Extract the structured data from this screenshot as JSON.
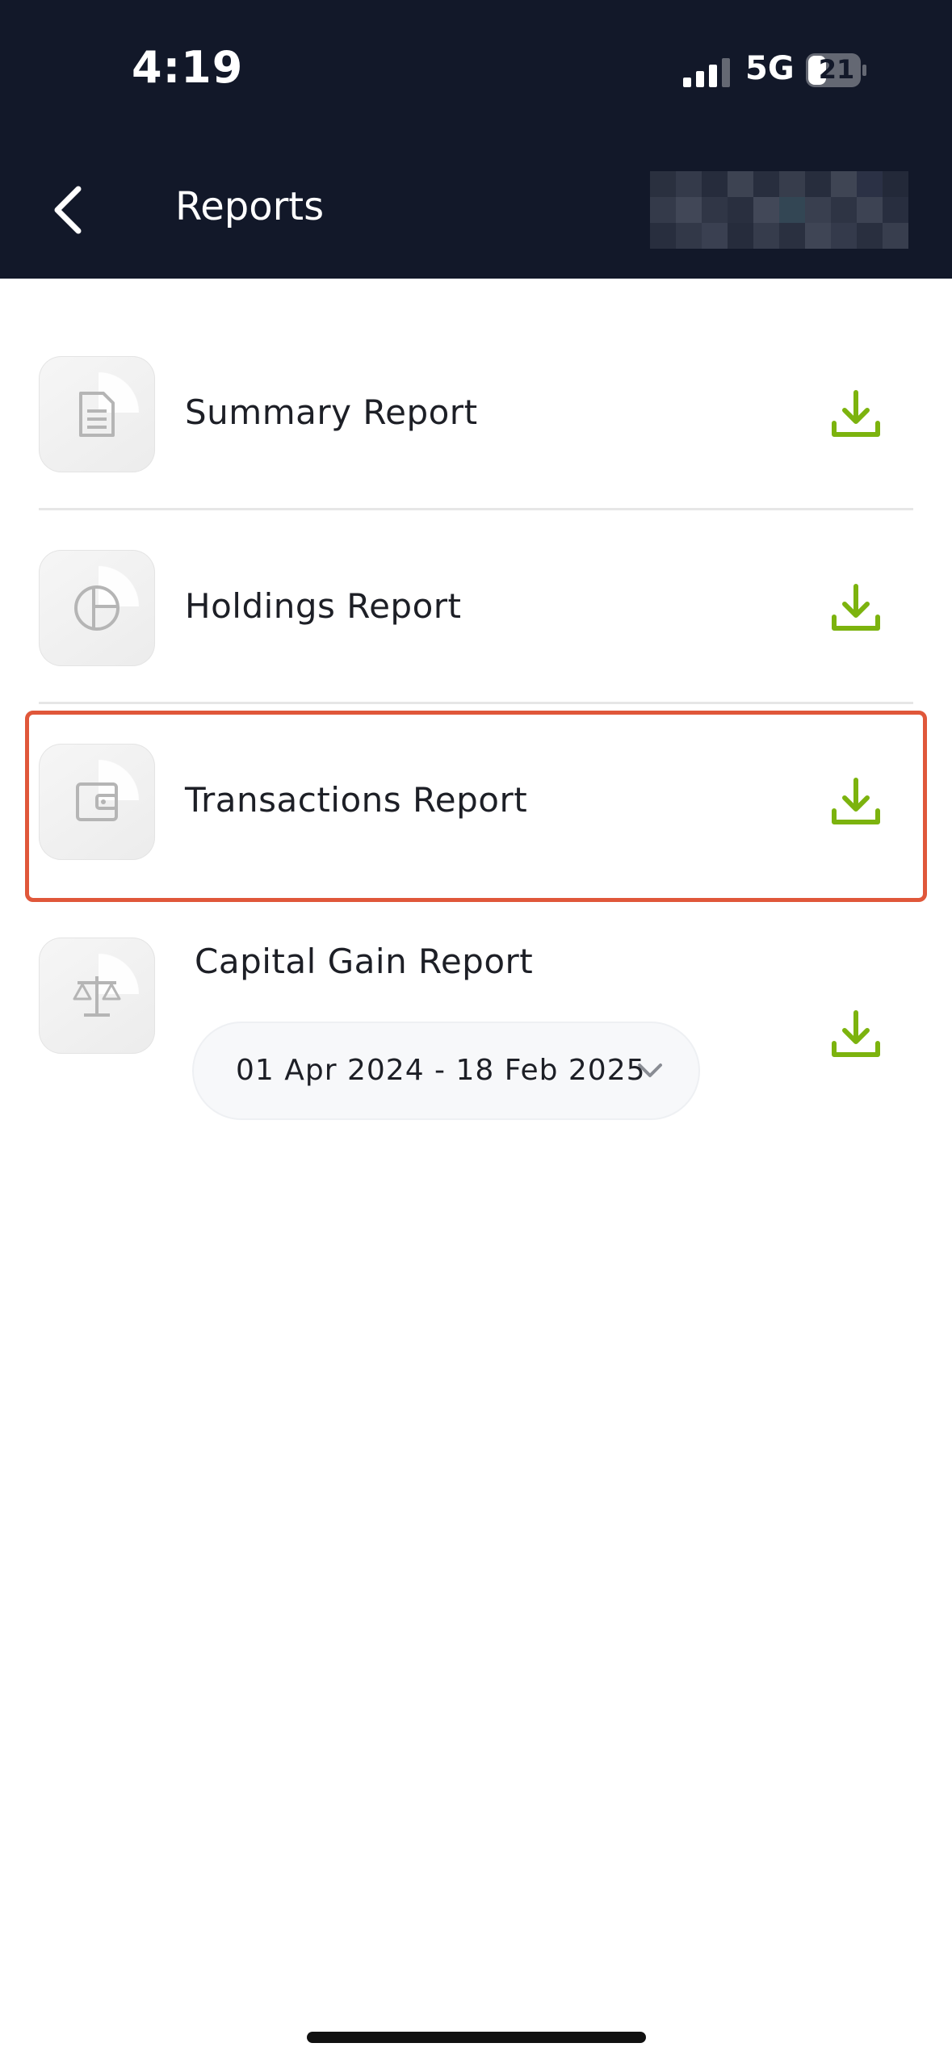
{
  "status_bar": {
    "time": "4:19",
    "network": "5G",
    "battery": "21"
  },
  "header": {
    "title": "Reports",
    "back_icon": "chevron-left-icon"
  },
  "reports": [
    {
      "label": "Summary Report",
      "icon": "document-icon"
    },
    {
      "label": "Holdings Report",
      "icon": "pie-chart-icon"
    },
    {
      "label": "Transactions Report",
      "icon": "wallet-icon"
    },
    {
      "label": "Capital Gain Report",
      "icon": "scales-icon"
    }
  ],
  "capital_gain": {
    "date_range": "01 Apr 2024 - 18 Feb 2025"
  },
  "colors": {
    "header_bg": "#121829",
    "download_accent": "#7cb30e",
    "highlight": "#e0573a"
  }
}
